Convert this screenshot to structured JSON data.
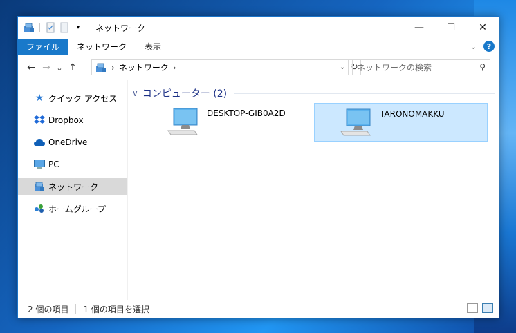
{
  "window": {
    "title": "ネットワーク",
    "controls": {
      "minimize": "—",
      "maximize": "☐",
      "close": "✕"
    }
  },
  "ribbon": {
    "tabs": [
      "ファイル",
      "ネットワーク",
      "表示"
    ],
    "help": "?"
  },
  "navigation": {
    "back": "←",
    "forward": "→",
    "recent": "⌄",
    "up": "↑"
  },
  "address": {
    "path": [
      "ネットワーク"
    ]
  },
  "search": {
    "placeholder": "ネットワークの検索"
  },
  "sidebar": {
    "items": [
      {
        "label": "クイック アクセス",
        "icon": "star-icon"
      },
      {
        "label": "Dropbox",
        "icon": "dropbox-icon"
      },
      {
        "label": "OneDrive",
        "icon": "onedrive-icon"
      },
      {
        "label": "PC",
        "icon": "pc-icon"
      },
      {
        "label": "ネットワーク",
        "icon": "network-icon",
        "selected": true
      },
      {
        "label": "ホームグループ",
        "icon": "homegroup-icon"
      }
    ]
  },
  "group": {
    "header": "コンピューター (2)"
  },
  "items": [
    {
      "label": "DESKTOP-GIB0A2D",
      "icon": "computer-icon",
      "selected": false
    },
    {
      "label": "TARONOMAKKU",
      "icon": "computer-icon",
      "selected": true
    }
  ],
  "status": {
    "item_count": "2 個の項目",
    "selected_count": "1 個の項目を選択"
  },
  "colors": {
    "accent": "#1979ca",
    "selection": "#cce8ff",
    "group_header": "#1e3287"
  }
}
